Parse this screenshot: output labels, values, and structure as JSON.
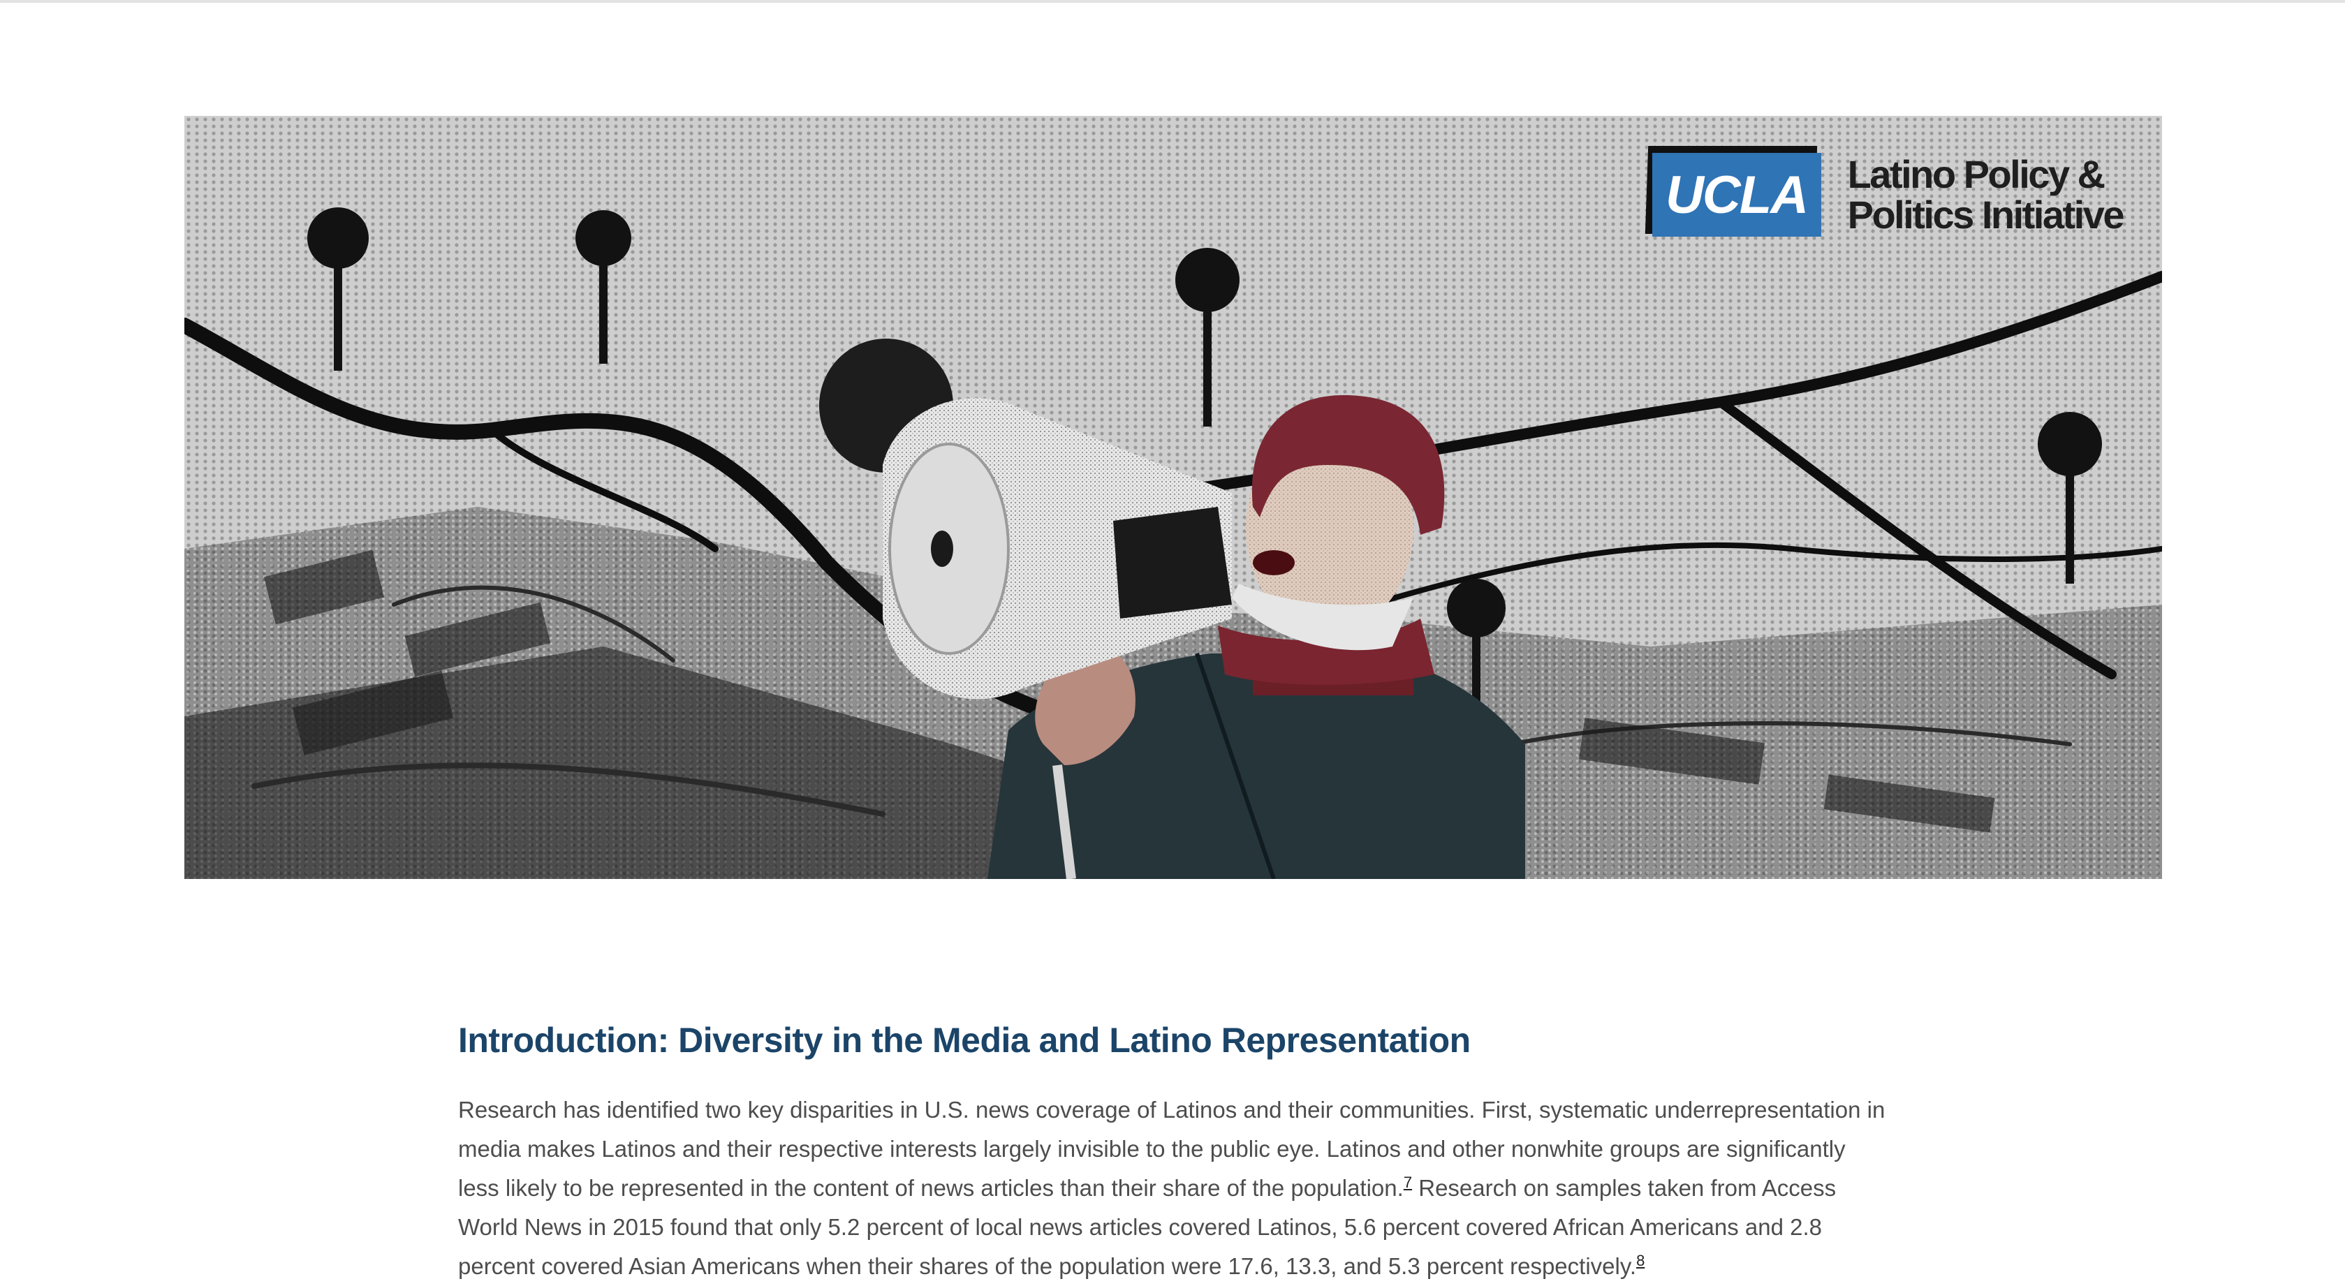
{
  "hero": {
    "logo_text": "UCLA",
    "org_line1": "Latino Policy &",
    "org_line2": "Politics Initiative",
    "image_description_icon": "protester-megaphone-map-image"
  },
  "article": {
    "heading": "Introduction: Diversity in the Media and Latino Representation",
    "p1_a": "Research has identified two key disparities in U.S. news coverage of Latinos and their communities. First, systematic underrepresentation in media makes Latinos and their respective interests largely invisible to the public eye. Latinos and other nonwhite groups are significantly less likely to be represented in the content of news articles than their share of the population.",
    "fn7": "7",
    "p1_b": " Research on samples taken from Access World News in 2015 found that only 5.2 percent of local news articles covered Latinos, 5.6 percent covered African Americans and 2.8 percent covered Asian Americans when their shares of the population were 17.6, 13.3, and 5.3 percent respectively.",
    "fn8": "8"
  },
  "colors": {
    "heading": "#1b4468",
    "body_text": "#4d4d4d",
    "ucla_blue": "#2f74b5",
    "hero_gray": "#cfcfcf"
  }
}
